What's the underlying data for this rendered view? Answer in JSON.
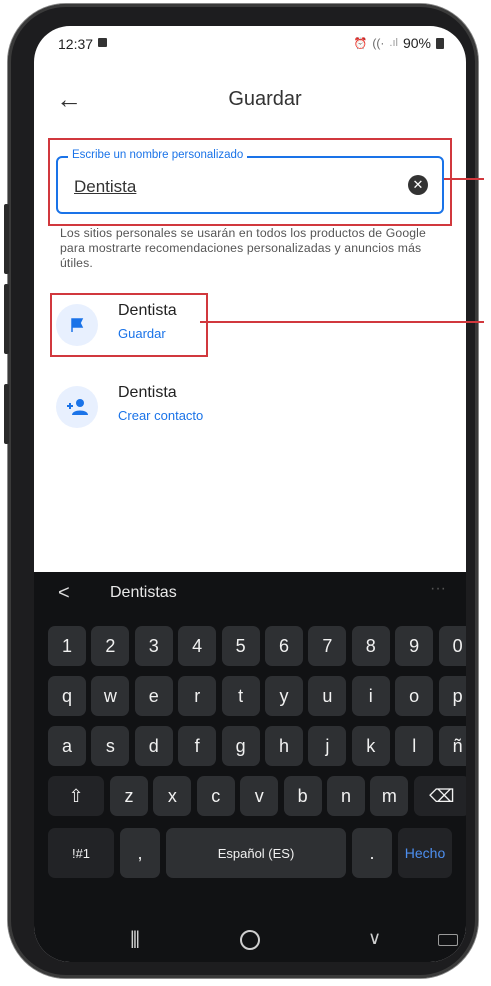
{
  "status": {
    "time": "12:37",
    "battery": "90%"
  },
  "appbar": {
    "back_icon": "←",
    "title": "Guardar"
  },
  "field": {
    "label": "Escribe un nombre personalizado",
    "value": "Dentista",
    "clear_icon": "✕"
  },
  "helper_text": "Los sitios personales se usarán en todos los productos de Google para mostrarte recomendaciones personalizadas y anuncios más útiles.",
  "options": [
    {
      "title": "Dentista",
      "action": "Guardar",
      "icon": "flag-icon"
    },
    {
      "title": "Dentista",
      "action": "Crear contacto",
      "icon": "add-person-icon"
    }
  ],
  "keyboard": {
    "suggestion": "Dentistas",
    "back_chevron": "<",
    "more_dots": "···",
    "row_numbers": [
      "1",
      "2",
      "3",
      "4",
      "5",
      "6",
      "7",
      "8",
      "9",
      "0"
    ],
    "row1": [
      "q",
      "w",
      "e",
      "r",
      "t",
      "y",
      "u",
      "i",
      "o",
      "p"
    ],
    "row2": [
      "a",
      "s",
      "d",
      "f",
      "g",
      "h",
      "j",
      "k",
      "l",
      "ñ"
    ],
    "row3": [
      "z",
      "x",
      "c",
      "v",
      "b",
      "n",
      "m"
    ],
    "shift_icon": "⇧",
    "backspace_icon": "⌫",
    "symbols": "!#1",
    "comma": ",",
    "space": "Español (ES)",
    "period": ".",
    "done": "Hecho"
  },
  "nav": {
    "recent": "|||",
    "home": "O",
    "back": "∨",
    "keyboard_icon": "keyboard-icon"
  },
  "colors": {
    "accent": "#1a73e8",
    "highlight": "#d1383d",
    "keyboard_bg": "#111214"
  }
}
